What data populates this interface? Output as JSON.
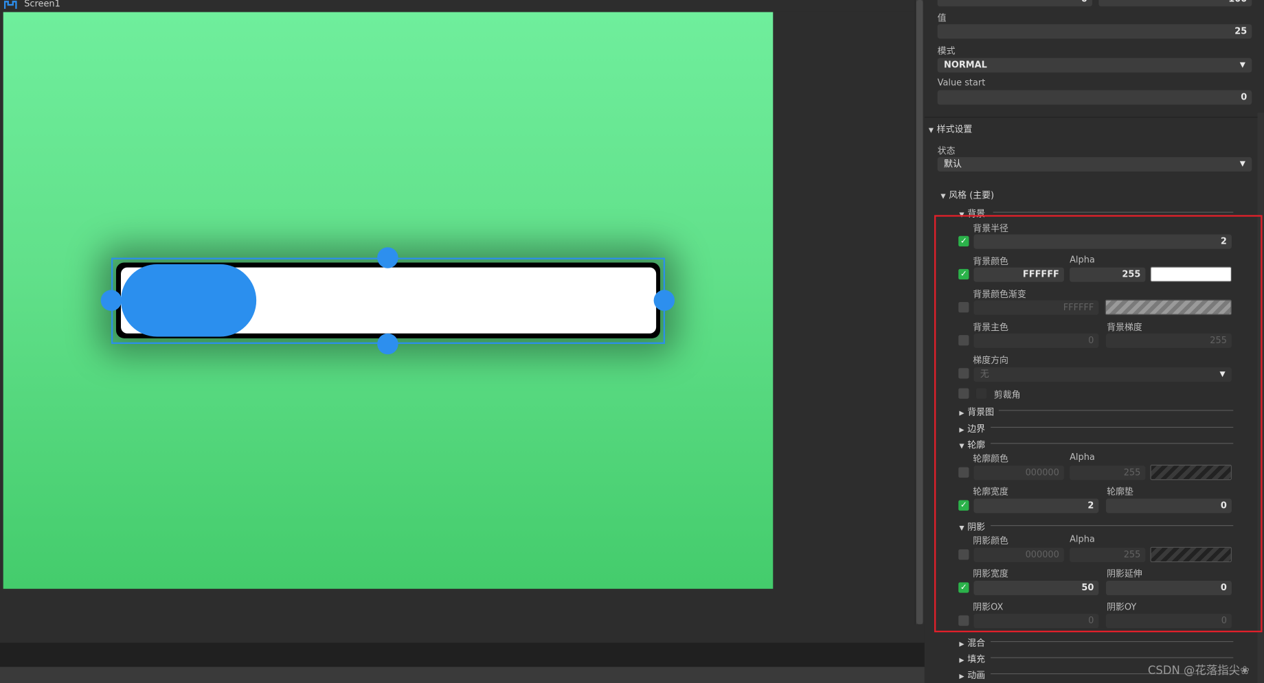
{
  "tab": {
    "title": "Screen1"
  },
  "props": {
    "value_label": "值",
    "value": "25",
    "mode_label": "模式",
    "mode_value": "NORMAL",
    "value_start_label": "Value start",
    "value_start": "0",
    "top_left_partial": "0",
    "top_right_partial": "100"
  },
  "style": {
    "section": "样式设置",
    "state_label": "状态",
    "state_value": "默认",
    "main_style": "风格 (主要)",
    "bg_section": "背景",
    "bg_radius_label": "背景半径",
    "bg_radius": "2",
    "bg_color_label": "背景颜色",
    "bg_color": "FFFFFF",
    "bg_alpha_label": "Alpha",
    "bg_alpha": "255",
    "bg_grad_label": "背景颜色渐变",
    "bg_grad": "FFFFFF",
    "bg_main_label": "背景主色",
    "bg_main": "0",
    "bg_grad_pct_label": "背景梯度",
    "bg_grad_pct": "255",
    "grad_dir_label": "梯度方向",
    "grad_dir": "无",
    "clip_label": "剪裁角",
    "bg_img": "背景图",
    "border": "边界",
    "outline": "轮廓",
    "outline_color_label": "轮廓颜色",
    "outline_color": "000000",
    "outline_alpha_label": "Alpha",
    "outline_alpha": "255",
    "outline_width_label": "轮廓宽度",
    "outline_width": "2",
    "outline_pad_label": "轮廓垫",
    "outline_pad": "0",
    "shadow": "阴影",
    "shadow_color_label": "阴影颜色",
    "shadow_color": "000000",
    "shadow_alpha_label": "Alpha",
    "shadow_alpha": "255",
    "shadow_width_label": "阴影宽度",
    "shadow_width": "50",
    "shadow_spread_label": "阴影延伸",
    "shadow_spread": "0",
    "shadow_ox_label": "阴影OX",
    "shadow_ox": "0",
    "shadow_oy_label": "阴影OY",
    "shadow_oy": "0",
    "blend": "混合",
    "fill": "填充",
    "anim": "动画"
  },
  "colors": {
    "accent": "#2d8fee",
    "check": "#2bb24a",
    "highlight": "#e0202a"
  },
  "watermark": "CSDN @花落指尖❀"
}
